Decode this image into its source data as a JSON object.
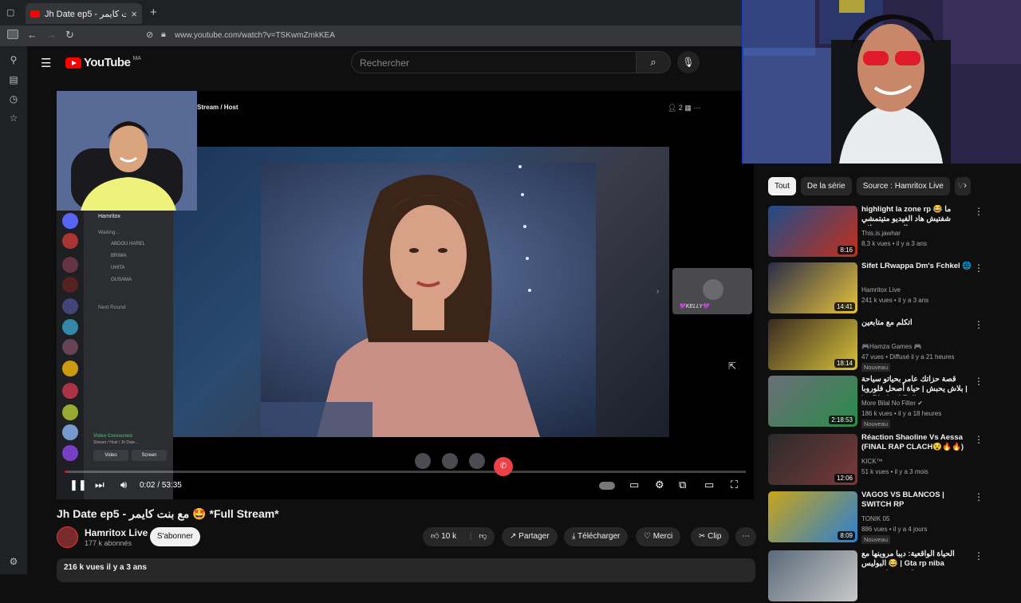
{
  "browser": {
    "tab_title": "Jh Date ep5 - مع بنت كايمر",
    "url": "www.youtube.com/watch?v=TSKwmZmkKEA",
    "new_tab": "+",
    "close": "×"
  },
  "youtube": {
    "logo": "YouTube",
    "region": "MA",
    "search_placeholder": "Rechercher"
  },
  "player": {
    "overlay_title": "Stream / Host",
    "side_label": "💜KELLY💜",
    "current_time": "0:02",
    "duration": "53:35",
    "progress_fraction": 0.002,
    "discord": {
      "user": "Hamritox",
      "channels": [
        "Waiting...",
        "ABDOU HAREL",
        "BRIWA",
        "UHITA",
        "OUSAMA",
        "Next Round"
      ],
      "voice_status": "Video Connected",
      "voice_sub": "Stream / Host / Jh Date...",
      "video_btn": "Video",
      "screen_btn": "Screen"
    }
  },
  "video": {
    "title": "Jh Date ep5 - مع بنت كايمر 🤩 *Full Stream*",
    "channel": "Hamritox Live",
    "subscribers": "177 k abonnés",
    "subscribe": "S'abonner",
    "likes": "10 k",
    "share": "Partager",
    "download": "Télécharger",
    "thanks": "Merci",
    "clip": "Clip",
    "more": "⋯",
    "views_date": "216 k vues  il y a 3 ans"
  },
  "sidebar": {
    "chips": [
      "Tout",
      "De la série",
      "Source : Hamritox Live",
      "V"
    ],
    "recommendations": [
      {
        "title": "highlight la zone rp 😂 ما شفتيش هاد الفيديو متيتمشي الدحص محيلاته",
        "channel": "This.is.jawhar",
        "meta": "8,3 k vues • il y a 3 ans",
        "duration": "8:16",
        "badge": "",
        "color1": "#1e4c8a",
        "color2": "#c2301a"
      },
      {
        "title": "Sifet LRwappa Dm's Fchkel 🌐",
        "channel": "Hamritox Live",
        "meta": "241 k vues • il y a 3 ans",
        "duration": "14:41",
        "badge": "",
        "color1": "#2a2c4a",
        "color2": "#e6c23a"
      },
      {
        "title": "اتكلم مع متابعين",
        "channel": "🎮Hamza Games 🎮",
        "meta": "47 vues • Diffusé il y a 21 heures",
        "duration": "18:14",
        "badge": "Nouveau",
        "color1": "#3a2a22",
        "color2": "#d7c23a"
      },
      {
        "title": "قصة حزاتك عامر بحياتو سياحة بلاش يحبش | حياة أصحل فلوروبا | Le Bledard Full ...",
        "channel": "More Bilal No Filter ✔",
        "meta": "186 k vues • il y a 18 heures",
        "duration": "2:18:53",
        "badge": "Nouveau",
        "color1": "#6b6e78",
        "color2": "#2a8b4a"
      },
      {
        "title": "Réaction Shaoline Vs Aessa (FINAL RAP CLACH😵🔥🔥)",
        "channel": "KICK™",
        "meta": "51 k vues • il y a 3 mois",
        "duration": "12:06",
        "badge": "",
        "color1": "#2a2a2a",
        "color2": "#7a3a3a"
      },
      {
        "title": "VAGOS VS BLANCOS | SWITCH RP",
        "channel": "TONIK 05",
        "meta": "886 vues • il y a 4 jours",
        "duration": "8:09",
        "badge": "Nouveau",
        "color1": "#c8a51c",
        "color2": "#2a7fd0"
      },
      {
        "title": "الحياة الواقعية: ديبا مروينها مع البوليس 😂 | Gta rp niba mrawnha mm3a...",
        "channel": "",
        "meta": "",
        "duration": "",
        "badge": "",
        "color1": "#5a6a7a",
        "color2": "#c9c9c9"
      }
    ]
  },
  "colors": {
    "bg": "#0f0f0f",
    "accent": "#ff0000",
    "chip": "#272727",
    "discord": "#5865f2"
  }
}
